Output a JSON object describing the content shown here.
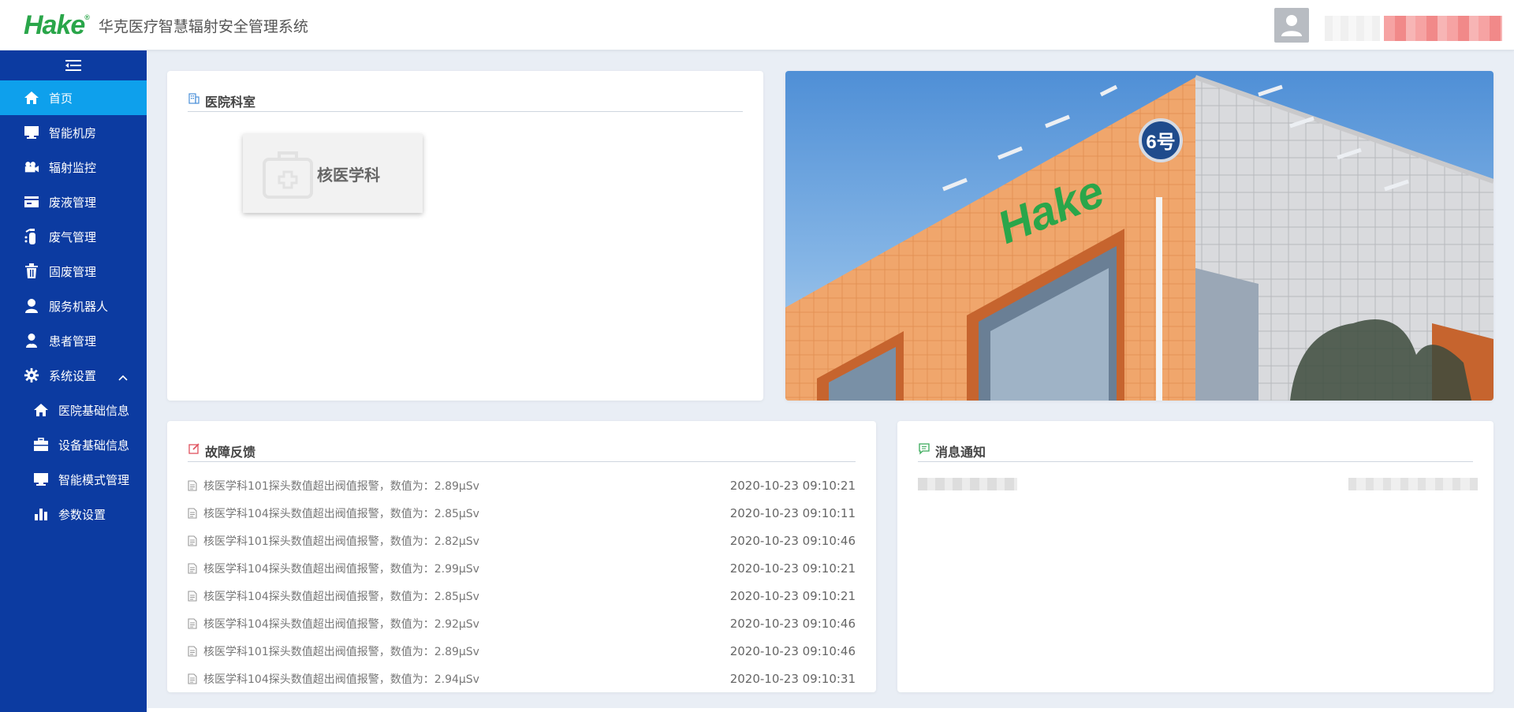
{
  "header": {
    "logo_text": "Hake",
    "logo_mark": "®",
    "system_title": "华克医疗智慧辐射安全管理系统"
  },
  "sidebar": {
    "items": [
      {
        "label": "首页",
        "icon": "home-icon",
        "active": true
      },
      {
        "label": "智能机房",
        "icon": "monitor-icon"
      },
      {
        "label": "辐射监控",
        "icon": "camera-icon"
      },
      {
        "label": "废液管理",
        "icon": "card-icon"
      },
      {
        "label": "废气管理",
        "icon": "fire-extinguisher-icon"
      },
      {
        "label": "固废管理",
        "icon": "trash-icon"
      },
      {
        "label": "服务机器人",
        "icon": "user-icon"
      },
      {
        "label": "患者管理",
        "icon": "person-icon"
      },
      {
        "label": "系统设置",
        "icon": "gear-icon",
        "expanded": true
      }
    ],
    "sub_items": [
      {
        "label": "医院基础信息",
        "icon": "home-icon"
      },
      {
        "label": "设备基础信息",
        "icon": "briefcase-icon"
      },
      {
        "label": "智能模式管理",
        "icon": "monitor-icon"
      },
      {
        "label": "参数设置",
        "icon": "bar-chart-icon"
      }
    ]
  },
  "dept_panel": {
    "title": "医院科室",
    "departments": [
      "核医学科"
    ]
  },
  "photo": {
    "building_logo": "Hake",
    "building_number": "6号"
  },
  "fault_panel": {
    "title": "故障反馈",
    "rows": [
      {
        "text": "核医学科101探头数值超出阀值报警，数值为：2.89μSv",
        "time": "2020-10-23 09:10:21"
      },
      {
        "text": "核医学科104探头数值超出阀值报警，数值为：2.85μSv",
        "time": "2020-10-23 09:10:11"
      },
      {
        "text": "核医学科101探头数值超出阀值报警，数值为：2.82μSv",
        "time": "2020-10-23 09:10:46"
      },
      {
        "text": "核医学科104探头数值超出阀值报警，数值为：2.99μSv",
        "time": "2020-10-23 09:10:21"
      },
      {
        "text": "核医学科104探头数值超出阀值报警，数值为：2.85μSv",
        "time": "2020-10-23 09:10:21"
      },
      {
        "text": "核医学科104探头数值超出阀值报警，数值为：2.92μSv",
        "time": "2020-10-23 09:10:46"
      },
      {
        "text": "核医学科101探头数值超出阀值报警，数值为：2.89μSv",
        "time": "2020-10-23 09:10:46"
      },
      {
        "text": "核医学科104探头数值超出阀值报警，数值为：2.94μSv",
        "time": "2020-10-23 09:10:31"
      }
    ]
  },
  "notice_panel": {
    "title": "消息通知"
  },
  "colors": {
    "sidebar_bg": "#0c3ba1",
    "active_item": "#0ea0ec",
    "brand_green": "#2aa64a"
  }
}
